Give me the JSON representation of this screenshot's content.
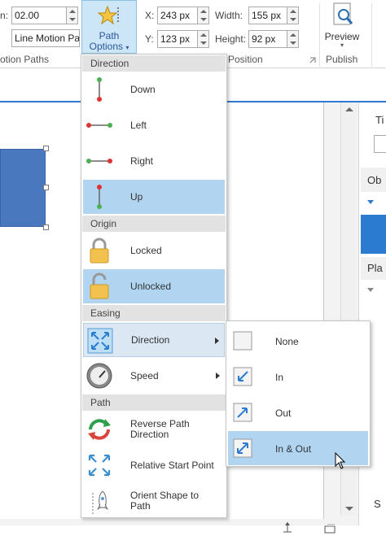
{
  "ribbon": {
    "duration_label": "n:",
    "duration_value": "02.00",
    "effect_value": "Line Motion Pat",
    "path_options_line1": "Path",
    "path_options_line2": "Options",
    "motion_paths_group": "otion Paths",
    "x_label": "X:",
    "x_value": "243 px",
    "y_label": "Y:",
    "y_value": "123 px",
    "width_label": "Width:",
    "width_value": "155 px",
    "height_label": "Height:",
    "height_value": "92 px",
    "position_group": "Position",
    "preview_label": "Preview",
    "publish_group": "Publish"
  },
  "right_pane": {
    "t1": "Ti",
    "t2": "Ob",
    "t3": "Pla",
    "t4": "S"
  },
  "path_menu": {
    "sections": [
      {
        "header": "Direction",
        "items": [
          "Down",
          "Left",
          "Right",
          "Up"
        ]
      },
      {
        "header": "Origin",
        "items": [
          "Locked",
          "Unlocked"
        ]
      },
      {
        "header": "Easing",
        "items": [
          "Direction",
          "Speed"
        ]
      },
      {
        "header": "Path",
        "items": [
          [
            "Reverse Path",
            "Direction"
          ],
          [
            "Relative Start Point"
          ],
          [
            "Orient Shape to",
            "Path"
          ]
        ]
      }
    ]
  },
  "easing_submenu": {
    "items": [
      "None",
      "In",
      "Out",
      "In & Out"
    ]
  },
  "colors": {
    "accent": "#2b579a",
    "selected_bg": "#b1d5f0",
    "shape_fill": "#4a78bf"
  }
}
